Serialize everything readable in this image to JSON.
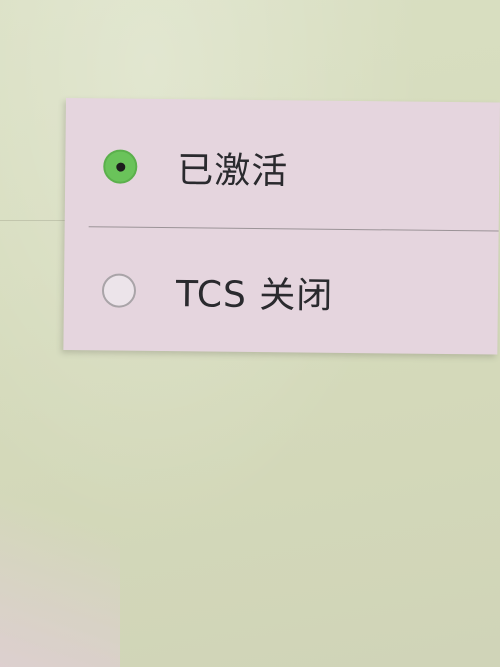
{
  "menu": {
    "items": [
      {
        "label": "已激活",
        "selected": true
      },
      {
        "label": "TCS 关闭",
        "selected": false
      }
    ]
  },
  "colors": {
    "panel": "#e5d5de",
    "radio_selected": "#6ac35a",
    "screen_background": "#d9dfc2"
  }
}
